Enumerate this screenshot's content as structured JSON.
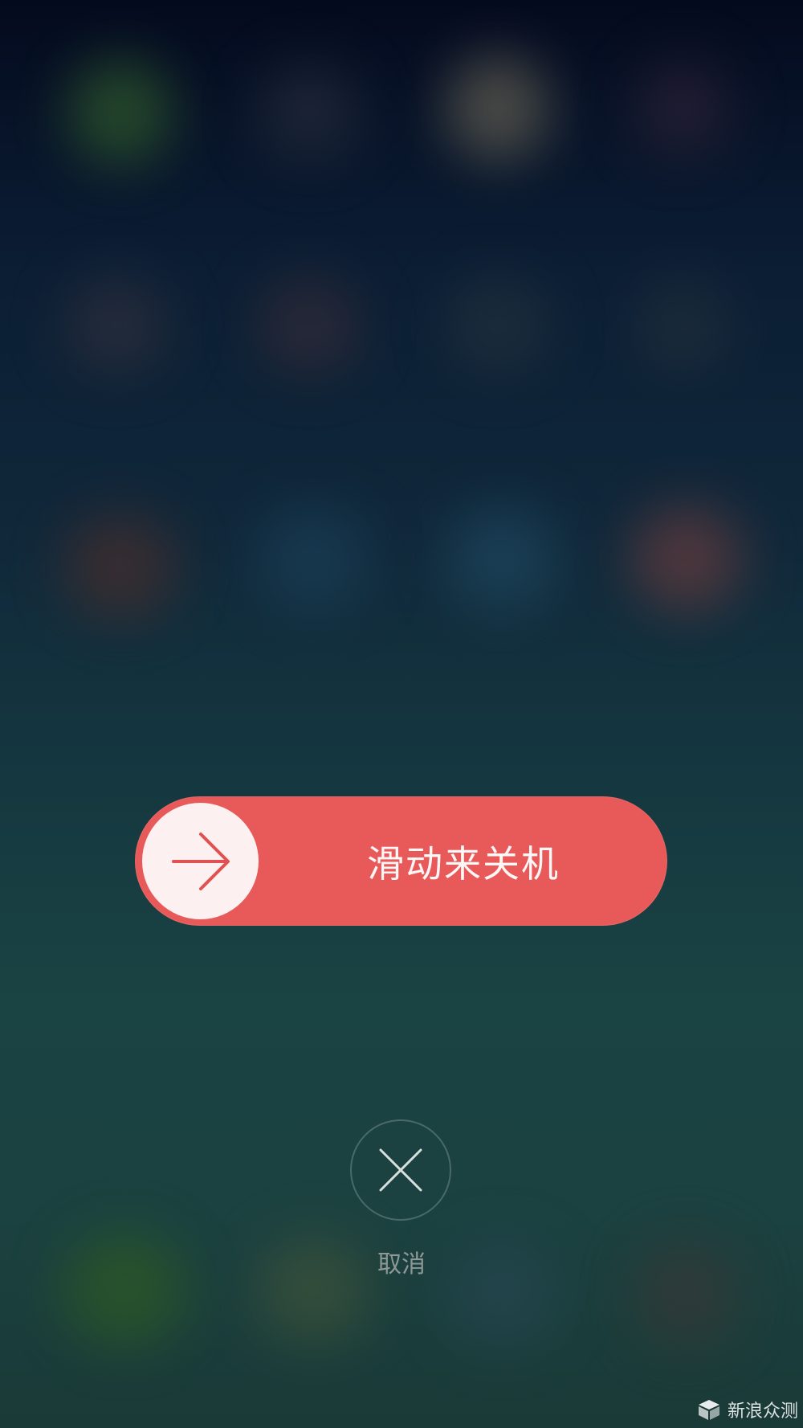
{
  "power_off": {
    "slide_label": "滑动来关机",
    "knob_icon": "arrow-right-icon",
    "accent_color": "#e85a5a",
    "knob_color": "#fcf0f0"
  },
  "cancel": {
    "icon": "close-icon",
    "label": "取消"
  },
  "watermark": {
    "text": "新浪众测",
    "icon": "cube-logo-icon"
  }
}
